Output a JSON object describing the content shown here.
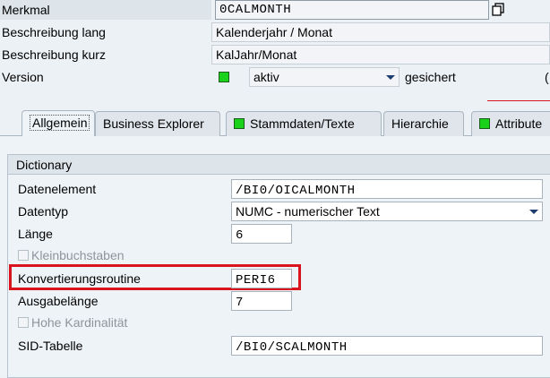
{
  "header": {
    "merkmal_label": "Merkmal",
    "merkmal_value": "0CALMONTH",
    "beschreibung_lang_label": "Beschreibung lang",
    "beschreibung_lang_value": "Kalenderjahr / Monat",
    "beschreibung_kurz_label": "Beschreibung kurz",
    "beschreibung_kurz_value": "KalJahr/Monat",
    "version_label": "Version",
    "version_value": "aktiv",
    "version_status": "gesichert",
    "right_cut_text": "("
  },
  "tabs": [
    {
      "label": "Allgemein",
      "active": true,
      "indicator": false
    },
    {
      "label": "Business Explorer",
      "active": false,
      "indicator": false
    },
    {
      "label": "Stammdaten/Texte",
      "active": false,
      "indicator": true
    },
    {
      "label": "Hierarchie",
      "active": false,
      "indicator": false
    },
    {
      "label": "Attribute",
      "active": false,
      "indicator": true
    }
  ],
  "dictionary": {
    "title": "Dictionary",
    "datenelement_label": "Datenelement",
    "datenelement_value": "/BI0/OICALMONTH",
    "datentyp_label": "Datentyp",
    "datentyp_value": "NUMC - numerischer Text",
    "laenge_label": "Länge",
    "laenge_value": "6",
    "kleinbuchstaben_label": "Kleinbuchstaben",
    "konvertierung_label": "Konvertierungsroutine",
    "konvertierung_value": "PERI6",
    "ausgabelaenge_label": "Ausgabelänge",
    "ausgabelaenge_value": "7",
    "hohe_kardinalitaet_label": "Hohe Kardinalität",
    "sid_tabelle_label": "SID-Tabelle",
    "sid_tabelle_value": "/BI0/SCALMONTH"
  },
  "colors": {
    "highlight_red": "#d9141e",
    "indicator_green": "#19d219",
    "background": "#ecf1f5"
  }
}
